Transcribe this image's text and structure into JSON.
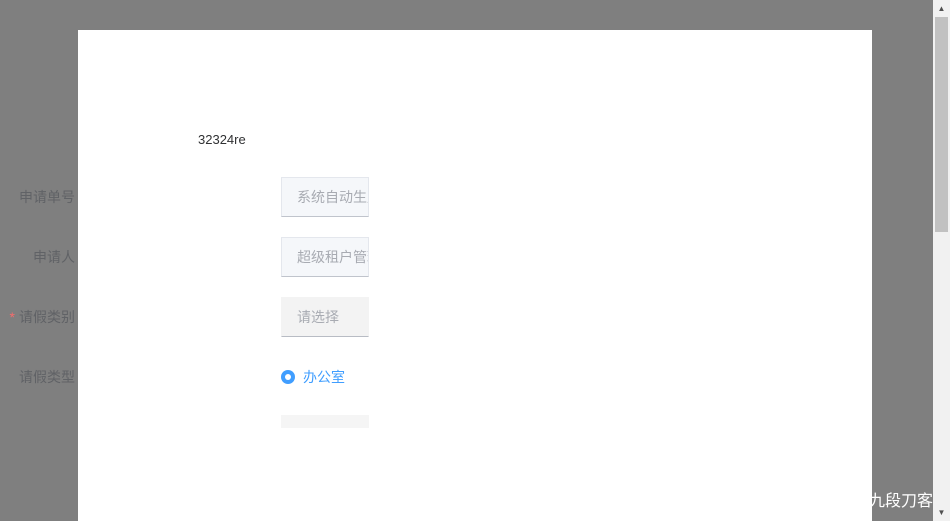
{
  "form": {
    "title": "32324re",
    "fields": [
      {
        "label": "申请单号",
        "placeholder": "系统自动生成",
        "required": false
      },
      {
        "label": "申请人",
        "placeholder": "超级租户管理员",
        "required": false
      },
      {
        "label": "请假类别",
        "placeholder": "请选择",
        "required": true
      },
      {
        "label": "请假类型",
        "option": "办公室",
        "checked": true
      }
    ],
    "required_mark": "*"
  },
  "watermark": "CSDN @九段刀客",
  "colors": {
    "primary": "#409eff",
    "required": "#f56c6c",
    "backdrop": "#7f7f7f"
  }
}
